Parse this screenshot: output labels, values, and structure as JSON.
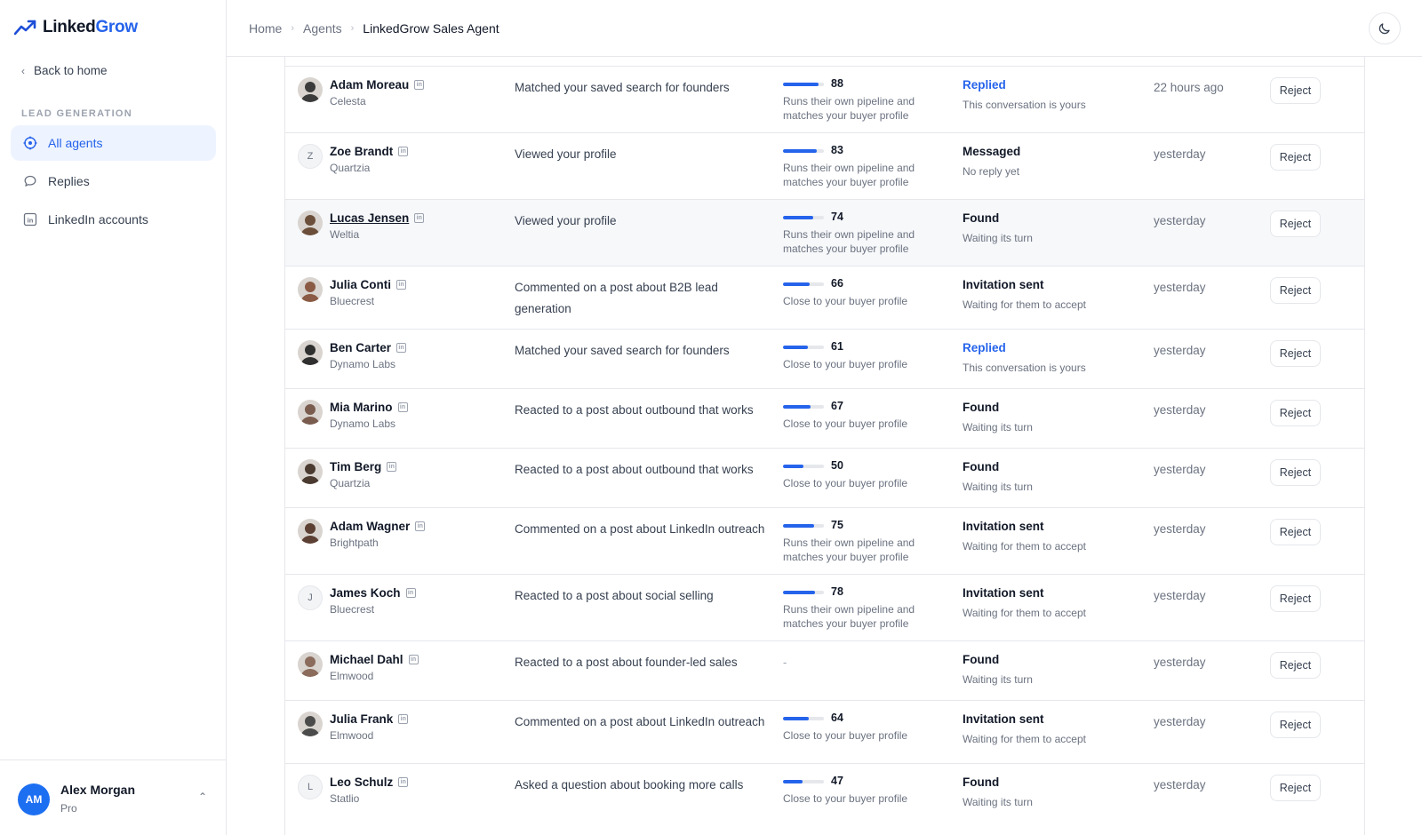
{
  "app": {
    "brand_main": "Linked",
    "brand_accent": "Grow",
    "accent_color": "#2563eb"
  },
  "sidebar": {
    "back_label": "Back to home",
    "section_label": "LEAD GENERATION",
    "items": [
      {
        "label": "All agents",
        "icon": "target-icon",
        "active": true
      },
      {
        "label": "Replies",
        "icon": "chat-bubble-icon",
        "active": false
      },
      {
        "label": "LinkedIn accounts",
        "icon": "linkedin-icon",
        "active": false
      }
    ],
    "user": {
      "initials": "AM",
      "name": "Alex Morgan",
      "plan": "Pro"
    }
  },
  "header": {
    "breadcrumb": [
      "Home",
      "Agents",
      "LinkedGrow Sales Agent"
    ],
    "theme_icon": "moon-icon"
  },
  "leads": {
    "reject_label": "Reject",
    "rows": [
      {
        "name": "Adam Moreau",
        "company": "Celesta",
        "reason": "Matched your saved search for founders",
        "score": 88,
        "fit": "Runs their own pipeline and matches your buyer profile",
        "status": "Replied",
        "status_sub": "This conversation is yours",
        "time": "22 hours ago",
        "avatar": "photo"
      },
      {
        "name": "Zoe Brandt",
        "company": "Quartzia",
        "reason": "Viewed your profile",
        "score": 83,
        "fit": "Runs their own pipeline and matches your buyer profile",
        "status": "Messaged",
        "status_sub": "No reply yet",
        "time": "yesterday",
        "avatar": "Z"
      },
      {
        "name": "Lucas Jensen",
        "company": "Weltia",
        "reason": "Viewed your profile",
        "score": 74,
        "fit": "Runs their own pipeline and matches your buyer profile",
        "status": "Found",
        "status_sub": "Waiting its turn",
        "time": "yesterday",
        "avatar": "photo"
      },
      {
        "name": "Julia Conti",
        "company": "Bluecrest",
        "reason": "Commented on a post about B2B lead generation",
        "score": 66,
        "fit": "Close to your buyer profile",
        "status": "Invitation sent",
        "status_sub": "Waiting for them to accept",
        "time": "yesterday",
        "avatar": "photo"
      },
      {
        "name": "Ben Carter",
        "company": "Dynamo Labs",
        "reason": "Matched your saved search for founders",
        "score": 61,
        "fit": "Close to your buyer profile",
        "status": "Replied",
        "status_sub": "This conversation is yours",
        "time": "yesterday",
        "avatar": "photo"
      },
      {
        "name": "Mia Marino",
        "company": "Dynamo Labs",
        "reason": "Reacted to a post about outbound that works",
        "score": 67,
        "fit": "Close to your buyer profile",
        "status": "Found",
        "status_sub": "Waiting its turn",
        "time": "yesterday",
        "avatar": "photo"
      },
      {
        "name": "Tim Berg",
        "company": "Quartzia",
        "reason": "Reacted to a post about outbound that works",
        "score": 50,
        "fit": "Close to your buyer profile",
        "status": "Found",
        "status_sub": "Waiting its turn",
        "time": "yesterday",
        "avatar": "photo"
      },
      {
        "name": "Adam Wagner",
        "company": "Brightpath",
        "reason": "Commented on a post about LinkedIn outreach",
        "score": 75,
        "fit": "Runs their own pipeline and matches your buyer profile",
        "status": "Invitation sent",
        "status_sub": "Waiting for them to accept",
        "time": "yesterday",
        "avatar": "photo"
      },
      {
        "name": "James Koch",
        "company": "Bluecrest",
        "reason": "Reacted to a post about social selling",
        "score": 78,
        "fit": "Runs their own pipeline and matches your buyer profile",
        "status": "Invitation sent",
        "status_sub": "Waiting for them to accept",
        "time": "yesterday",
        "avatar": "J"
      },
      {
        "name": "Michael Dahl",
        "company": "Elmwood",
        "reason": "Reacted to a post about founder-led sales",
        "score": null,
        "score_text": "-",
        "fit": "",
        "status": "Found",
        "status_sub": "Waiting its turn",
        "time": "yesterday",
        "avatar": "photo"
      },
      {
        "name": "Julia Frank",
        "company": "Elmwood",
        "reason": "Commented on a post about LinkedIn outreach",
        "score": 64,
        "fit": "Close to your buyer profile",
        "status": "Invitation sent",
        "status_sub": "Waiting for them to accept",
        "time": "yesterday",
        "avatar": "photo"
      },
      {
        "name": "Leo Schulz",
        "company": "Statlio",
        "reason": "Asked a question about booking more calls",
        "score": 47,
        "fit": "Close to your buyer profile",
        "status": "Found",
        "status_sub": "Waiting its turn",
        "time": "yesterday",
        "avatar": "L"
      }
    ]
  }
}
